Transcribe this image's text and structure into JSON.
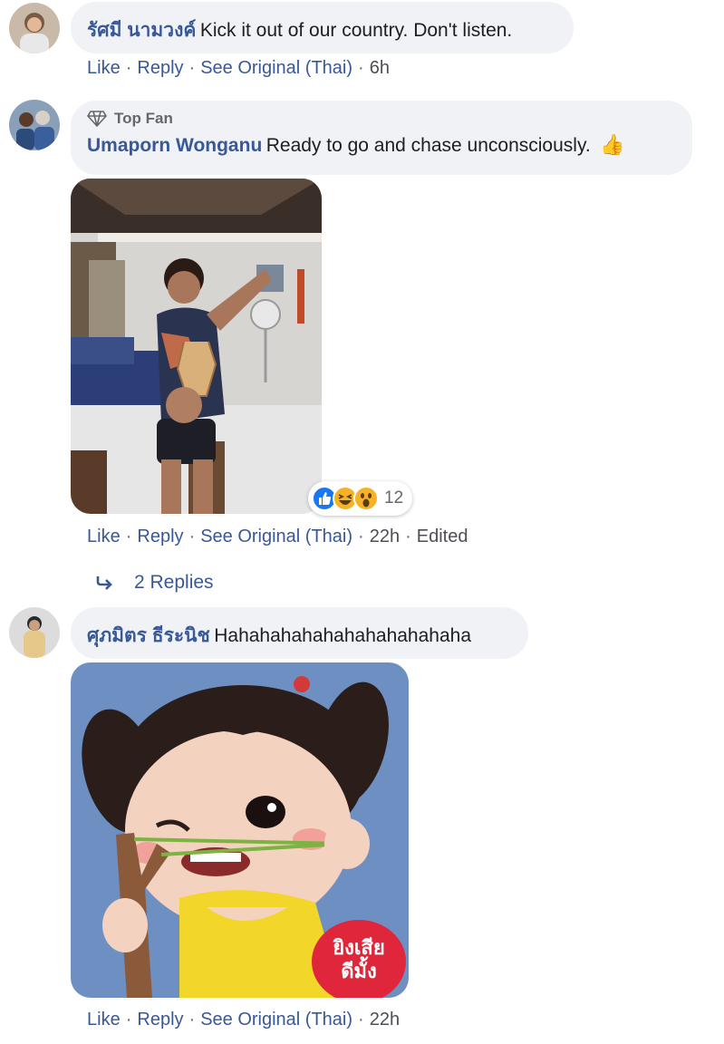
{
  "comments": [
    {
      "author": "รัศมี นามวงค์",
      "text": "Kick it out of our country. Don't listen.",
      "actions": {
        "like": "Like",
        "reply": "Reply",
        "see_original": "See Original (Thai)",
        "time": "6h"
      }
    },
    {
      "badge": "Top Fan",
      "author": "Umaporn Wonganu",
      "text": "Ready to go and chase unconsciously.",
      "emoji": "👍",
      "reactions": {
        "icons": [
          "like-icon",
          "haha-icon",
          "wow-icon"
        ],
        "count": "12"
      },
      "actions": {
        "like": "Like",
        "reply": "Reply",
        "see_original": "See Original (Thai)",
        "time": "22h",
        "edited": "Edited"
      },
      "replies_label": "2 Replies"
    },
    {
      "author": "ศุภมิตร ธีระนิช",
      "text": "Hahahahahahahahahahahaha",
      "sticker_text": [
        "ยิงเสีย",
        "ดีมั้ง"
      ],
      "actions": {
        "like": "Like",
        "reply": "Reply",
        "see_original": "See Original (Thai)",
        "time": "22h"
      }
    }
  ],
  "colors": {
    "link": "#385898",
    "bubble": "#f0f2f5",
    "secondary": "#65676b"
  }
}
